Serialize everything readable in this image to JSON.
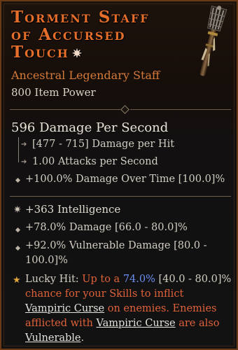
{
  "item": {
    "title_line1": "Torment Staff",
    "title_line2": "of Accursed",
    "title_line3": "Touch",
    "title_star": "✷",
    "type": "Ancestral Legendary Staff",
    "item_power": "800 Item Power"
  },
  "weapon": {
    "dps": "596 Damage Per Second",
    "damage_per_hit": "[477 - 715] Damage per Hit",
    "attacks_per_second": "1.00 Attacks per Second",
    "implicit": "+100.0% Damage Over Time [100.0]%"
  },
  "affixes": {
    "intelligence": "+363 Intelligence",
    "damage": "+78.0% Damage [66.0 - 80.0]%",
    "vulnerable_line1": "+92.0% Vulnerable Damage [80.0 -",
    "vulnerable_line2": "100.0]%"
  },
  "lucky_hit": {
    "label": "Lucky Hit:",
    "text1": "Up to a",
    "value": "74.0%",
    "range": "[40.0 - 80.0]%",
    "text2": "chance for your Skills to inflict",
    "curse1": "Vampiric Curse",
    "text3": "on enemies. Enemies",
    "text4": "afflicted with",
    "curse2": "Vampiric Curse",
    "text5": "are also",
    "vulnerable": "Vulnerable",
    "period": "."
  },
  "colors": {
    "legendary_orange": "#e46e2a",
    "lucky_text": "#e0623a",
    "highlight_blue": "#6b8ff2",
    "lucky_star": "#e1a83a"
  },
  "icons": {
    "title_icon": "legendary-aspect-star-icon",
    "weapon": "staff-icon"
  }
}
